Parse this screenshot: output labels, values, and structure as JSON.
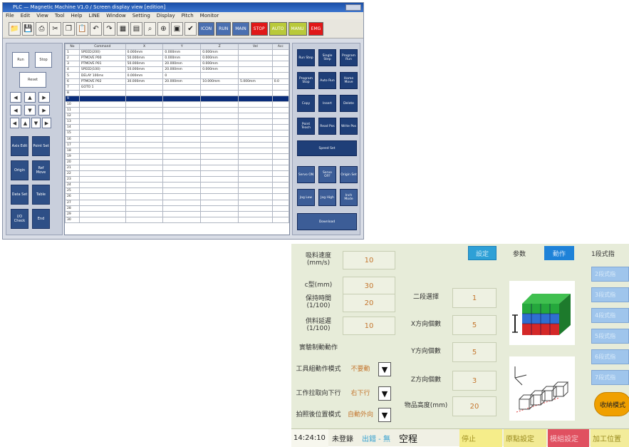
{
  "win1": {
    "title": "PLC — Magnetic Machine V1.0 / Screen display view [edition]",
    "menu": [
      "File",
      "Edit",
      "View",
      "Tool",
      "Help",
      "LINE",
      "Window",
      "Setting",
      "Display",
      "Pitch",
      "Monitor"
    ],
    "toolbar_icons": [
      "folder-icon",
      "save-icon",
      "print-icon",
      "cut-icon",
      "copy-icon",
      "paste-icon",
      "undo-icon",
      "redo-icon",
      "grid-icon",
      "chart-icon",
      "find-icon",
      "zoom-icon",
      "image-icon",
      "check-icon"
    ],
    "toolbar_buttons": [
      {
        "label": "ICON",
        "color": "#4a6fb0"
      },
      {
        "label": "RUN",
        "color": "#4a6fb0"
      },
      {
        "label": "MAIN",
        "color": "#4a6fb0"
      },
      {
        "label": "STOP",
        "color": "#e01818"
      },
      {
        "label": "AUTO",
        "color": "#b9c93a"
      },
      {
        "label": "MANU",
        "color": "#b9c93a"
      },
      {
        "label": "EMG",
        "color": "#e01818"
      }
    ],
    "left_top_buttons": [
      "Run",
      "Stop",
      "Reset"
    ],
    "left_arrow_buttons": [
      "◀",
      "▲",
      "▶",
      "◀",
      "▼",
      "▶",
      "◀",
      "▲",
      "▼",
      "▶"
    ],
    "left_dark_buttons": [
      "Axis Edit",
      "Point Set",
      "Origin",
      "Ref Move",
      "Data Set",
      "Table",
      "I/O Check",
      "End"
    ],
    "grid": {
      "headers": [
        "No",
        "Command",
        "X",
        "Y",
        "Z",
        "Vel",
        "Acc"
      ],
      "rows": [
        [
          "1",
          "SPEED(200)",
          "0.000mm",
          "0.000mm",
          "0.000mm",
          "",
          ""
        ],
        [
          "2",
          "PTMOVE P00",
          "50.000mm",
          "0.000mm",
          "0.000mm",
          "",
          ""
        ],
        [
          "3",
          "PTMOVE P01",
          "50.000mm",
          "20.000mm",
          "0.000mm",
          "",
          ""
        ],
        [
          "4",
          "SPEED(100)",
          "50.000mm",
          "20.000mm",
          "0.000mm",
          "",
          ""
        ],
        [
          "5",
          "DELAY 100ms",
          "0.000mm",
          "0",
          "",
          "",
          ""
        ],
        [
          "6",
          "PTMOVE P02",
          "30.000mm",
          "20.000mm",
          "10.000mm",
          "5.000mm",
          "0.0"
        ],
        [
          "7",
          "GOTO 1",
          "",
          "",
          "",
          "",
          ""
        ],
        [
          "8",
          "",
          "",
          "",
          "",
          "",
          ""
        ],
        [
          "9",
          "",
          "",
          "",
          "",
          "",
          ""
        ],
        [
          "10",
          "",
          "",
          "",
          "",
          "",
          ""
        ],
        [
          "11",
          "",
          "",
          "",
          "",
          "",
          ""
        ],
        [
          "12",
          "",
          "",
          "",
          "",
          "",
          ""
        ],
        [
          "13",
          "",
          "",
          "",
          "",
          "",
          ""
        ],
        [
          "14",
          "",
          "",
          "",
          "",
          "",
          ""
        ],
        [
          "15",
          "",
          "",
          "",
          "",
          "",
          ""
        ],
        [
          "16",
          "",
          "",
          "",
          "",
          "",
          ""
        ],
        [
          "17",
          "",
          "",
          "",
          "",
          "",
          ""
        ],
        [
          "18",
          "",
          "",
          "",
          "",
          "",
          ""
        ],
        [
          "19",
          "",
          "",
          "",
          "",
          "",
          ""
        ],
        [
          "20",
          "",
          "",
          "",
          "",
          "",
          ""
        ],
        [
          "21",
          "",
          "",
          "",
          "",
          "",
          ""
        ],
        [
          "22",
          "",
          "",
          "",
          "",
          "",
          ""
        ],
        [
          "23",
          "",
          "",
          "",
          "",
          "",
          ""
        ],
        [
          "24",
          "",
          "",
          "",
          "",
          "",
          ""
        ],
        [
          "25",
          "",
          "",
          "",
          "",
          "",
          ""
        ],
        [
          "26",
          "",
          "",
          "",
          "",
          "",
          ""
        ],
        [
          "27",
          "",
          "",
          "",
          "",
          "",
          ""
        ],
        [
          "28",
          "",
          "",
          "",
          "",
          "",
          ""
        ],
        [
          "29",
          "",
          "",
          "",
          "",
          "",
          ""
        ],
        [
          "30",
          "",
          "",
          "",
          "",
          "",
          ""
        ]
      ],
      "selected_row": 8
    },
    "right_buttons": [
      "Run Step",
      "Single Step",
      "Program Run",
      "Program Stop",
      "Auto Run",
      "Home Move",
      "Copy",
      "Insert",
      "Delete",
      "Point Teach",
      "Read Pos",
      "Write Pos",
      "Speed Set"
    ],
    "right_light_buttons": [
      "Servo ON",
      "Servo OFF",
      "Origin Set",
      "Jog Low",
      "Jog High",
      "Inch Mode"
    ],
    "right_bottom": "Download"
  },
  "win2": {
    "tabs": [
      "設定",
      "参数",
      "動作",
      "1段式指"
    ],
    "fields_left": [
      {
        "label": "吸料速度(mm/s)",
        "value": "10"
      },
      {
        "label": "c型(mm)",
        "value": "30"
      },
      {
        "label": "保持時間(1/100)",
        "value": "20"
      },
      {
        "label": "供料延遲(1/100)",
        "value": "10"
      },
      {
        "label": "實驗制動動作",
        "value": ""
      },
      {
        "label": "工具組動作模式",
        "value": "不要動"
      },
      {
        "label": "工作拉取向下行",
        "value": "右下行"
      },
      {
        "label": "拍照後位置模式",
        "value": "自動外向"
      }
    ],
    "fields_mid": [
      {
        "label": "二段選擇",
        "value": "1"
      },
      {
        "label": "X方向個數",
        "value": "5"
      },
      {
        "label": "Y方向個數",
        "value": "5"
      },
      {
        "label": "Z方向個數",
        "value": "3"
      },
      {
        "label": "物品高度(mm)",
        "value": "20"
      }
    ],
    "side_buttons": [
      "2段式指",
      "3段式指",
      "4段式指",
      "5段式指",
      "6段式指",
      "7段式指"
    ],
    "orange_button": "收納模式",
    "status": {
      "time": "14:24:10",
      "items": [
        "未登錄",
        "出錯 - 無",
        "空程",
        "停止",
        "原點設定",
        "模組設定",
        "加工位置"
      ]
    },
    "colors": {
      "accent_blue": "#1e82d8",
      "value_orange": "#c4762e",
      "orange_btn": "#f0a000",
      "red_btn": "#e05060"
    }
  }
}
